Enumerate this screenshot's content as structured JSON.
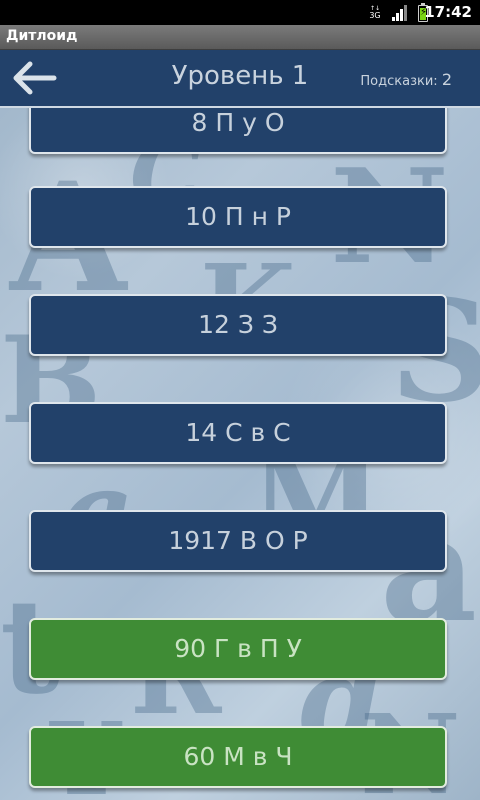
{
  "status_bar": {
    "signal_type": "3G",
    "time": "17:42"
  },
  "app": {
    "title": "Дитлоид"
  },
  "header": {
    "level_title": "Уровень 1",
    "hints_label": "Подсказки:",
    "hints_count": "2"
  },
  "puzzles": [
    {
      "text": "8 П у О",
      "solved": false
    },
    {
      "text": "10 П н Р",
      "solved": false
    },
    {
      "text": "12 З З",
      "solved": false
    },
    {
      "text": "14 С в С",
      "solved": false
    },
    {
      "text": "1917 В О Р",
      "solved": false
    },
    {
      "text": "90 Г в П У",
      "solved": true
    },
    {
      "text": "60 М в Ч",
      "solved": true
    }
  ],
  "colors": {
    "unsolved": "#22416a",
    "solved": "#3f8c35",
    "navbar": "#22416a"
  },
  "icons": {
    "back": "arrow-left-icon"
  }
}
